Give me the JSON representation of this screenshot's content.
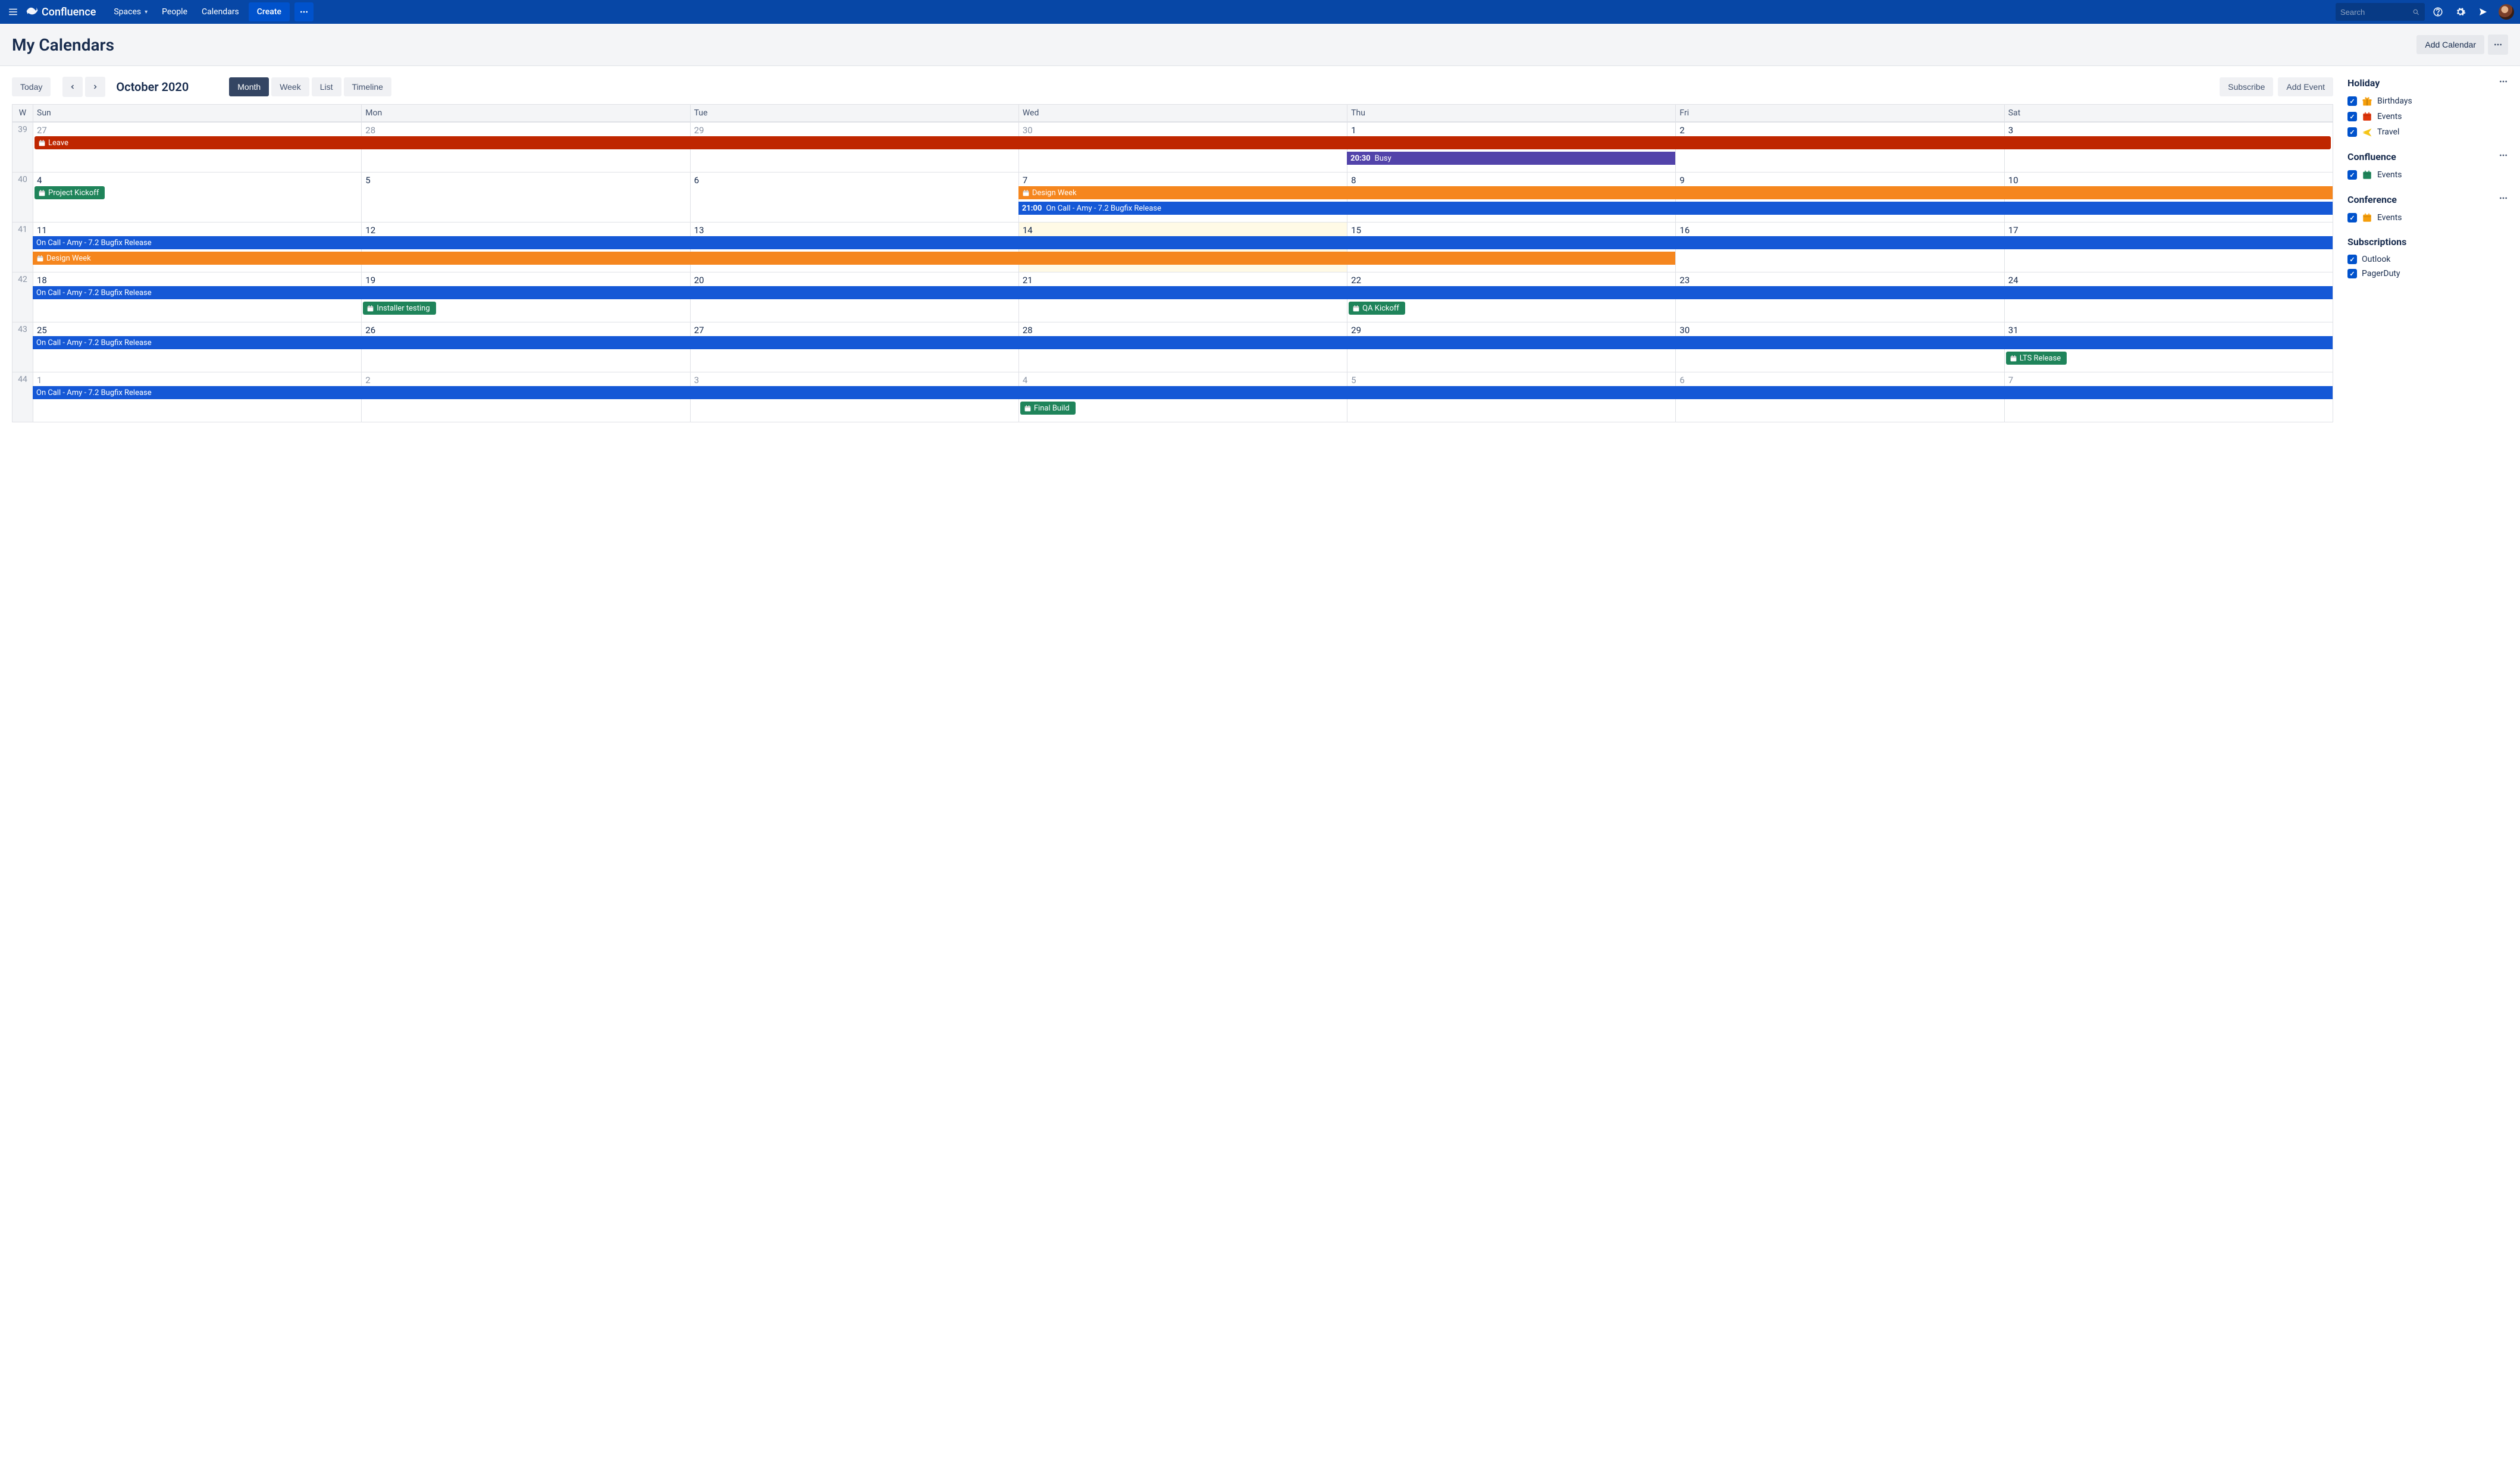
{
  "nav": {
    "brand": "Confluence",
    "items": [
      "Spaces",
      "People",
      "Calendars"
    ],
    "create": "Create",
    "search_placeholder": "Search"
  },
  "page": {
    "title": "My Calendars",
    "add_calendar": "Add Calendar"
  },
  "toolbar": {
    "today": "Today",
    "month_label": "October 2020",
    "views": [
      "Month",
      "Week",
      "List",
      "Timeline"
    ],
    "active_view": "Month",
    "subscribe": "Subscribe",
    "add_event": "Add Event"
  },
  "cal": {
    "week_col": "W",
    "day_headers": [
      "Sun",
      "Mon",
      "Tue",
      "Wed",
      "Thu",
      "Fri",
      "Sat"
    ],
    "rows": [
      {
        "wk": "39",
        "days": [
          {
            "n": "27",
            "other": true
          },
          {
            "n": "28",
            "other": true
          },
          {
            "n": "29",
            "other": true
          },
          {
            "n": "30",
            "other": true
          },
          {
            "n": "1"
          },
          {
            "n": "2"
          },
          {
            "n": "3"
          }
        ],
        "h": 80,
        "events": [
          {
            "title": "Leave",
            "color": "red",
            "icon": true,
            "start": 0,
            "span": 7,
            "row": 0,
            "pad": true
          },
          {
            "time": "20:30",
            "title": "Busy",
            "color": "purple",
            "start": 4,
            "span": 1,
            "row": 1
          }
        ]
      },
      {
        "wk": "40",
        "days": [
          {
            "n": "4"
          },
          {
            "n": "5"
          },
          {
            "n": "6"
          },
          {
            "n": "7"
          },
          {
            "n": "8"
          },
          {
            "n": "9"
          },
          {
            "n": "10"
          }
        ],
        "h": 80,
        "events": [
          {
            "title": "Project Kickoff",
            "color": "green",
            "icon": true,
            "start": 0,
            "span": 1,
            "row": 0,
            "pad": true,
            "shrink": true
          },
          {
            "title": "Design Week",
            "color": "orange",
            "icon": true,
            "start": 3,
            "span": 4,
            "row": 0
          },
          {
            "time": "21:00",
            "title": "On Call - Amy - 7.2 Bugfix Release",
            "color": "blue",
            "start": 3,
            "span": 4,
            "row": 1
          }
        ]
      },
      {
        "wk": "41",
        "days": [
          {
            "n": "11"
          },
          {
            "n": "12"
          },
          {
            "n": "13"
          },
          {
            "n": "14",
            "today": true
          },
          {
            "n": "15"
          },
          {
            "n": "16"
          },
          {
            "n": "17"
          }
        ],
        "h": 80,
        "events": [
          {
            "title": "On Call - Amy - 7.2 Bugfix Release",
            "color": "blue",
            "start": 0,
            "span": 7,
            "row": 0
          },
          {
            "title": "Design Week",
            "color": "orange",
            "icon": true,
            "start": 0,
            "span": 5,
            "row": 1
          }
        ]
      },
      {
        "wk": "42",
        "days": [
          {
            "n": "18"
          },
          {
            "n": "19"
          },
          {
            "n": "20"
          },
          {
            "n": "21"
          },
          {
            "n": "22"
          },
          {
            "n": "23"
          },
          {
            "n": "24"
          }
        ],
        "h": 80,
        "events": [
          {
            "title": "On Call - Amy - 7.2 Bugfix Release",
            "color": "blue",
            "start": 0,
            "span": 7,
            "row": 0
          },
          {
            "title": "Installer testing",
            "color": "green",
            "icon": true,
            "start": 1,
            "span": 1,
            "row": 1,
            "pad": true,
            "shrink": true
          },
          {
            "title": "QA Kickoff",
            "color": "green",
            "icon": true,
            "start": 4,
            "span": 1,
            "row": 1,
            "pad": true,
            "shrink": true
          }
        ]
      },
      {
        "wk": "43",
        "days": [
          {
            "n": "25"
          },
          {
            "n": "26"
          },
          {
            "n": "27"
          },
          {
            "n": "28"
          },
          {
            "n": "29"
          },
          {
            "n": "30"
          },
          {
            "n": "31"
          }
        ],
        "h": 80,
        "events": [
          {
            "title": "On Call - Amy - 7.2 Bugfix Release",
            "color": "blue",
            "start": 0,
            "span": 7,
            "row": 0
          },
          {
            "title": "LTS Release",
            "color": "green",
            "icon": true,
            "start": 6,
            "span": 1,
            "row": 1,
            "pad": true,
            "shrink": true
          }
        ]
      },
      {
        "wk": "44",
        "days": [
          {
            "n": "1",
            "other": true
          },
          {
            "n": "2",
            "other": true
          },
          {
            "n": "3",
            "other": true
          },
          {
            "n": "4",
            "other": true
          },
          {
            "n": "5",
            "other": true
          },
          {
            "n": "6",
            "other": true
          },
          {
            "n": "7",
            "other": true
          }
        ],
        "h": 80,
        "events": [
          {
            "title": "On Call - Amy - 7.2 Bugfix Release",
            "color": "blue",
            "start": 0,
            "span": 7,
            "row": 0
          },
          {
            "title": "Final Build",
            "color": "green",
            "icon": true,
            "start": 3,
            "span": 1,
            "row": 1,
            "pad": true,
            "shrink": true
          }
        ]
      }
    ]
  },
  "sidebar": {
    "groups": [
      {
        "title": "Holiday",
        "dots": true,
        "items": [
          {
            "label": "Birthdays",
            "icon": "gift",
            "iconClass": "ic-orange"
          },
          {
            "label": "Events",
            "icon": "cal",
            "iconClass": "ic-red"
          },
          {
            "label": "Travel",
            "icon": "plane",
            "iconClass": "ic-yellow"
          }
        ]
      },
      {
        "title": "Confluence",
        "dots": true,
        "items": [
          {
            "label": "Events",
            "icon": "cal",
            "iconClass": "ic-green"
          }
        ]
      },
      {
        "title": "Conference",
        "dots": true,
        "items": [
          {
            "label": "Events",
            "icon": "cal",
            "iconClass": "ic-orange"
          }
        ]
      },
      {
        "title": "Subscriptions",
        "dots": false,
        "items": [
          {
            "label": "Outlook"
          },
          {
            "label": "PagerDuty"
          }
        ]
      }
    ]
  }
}
